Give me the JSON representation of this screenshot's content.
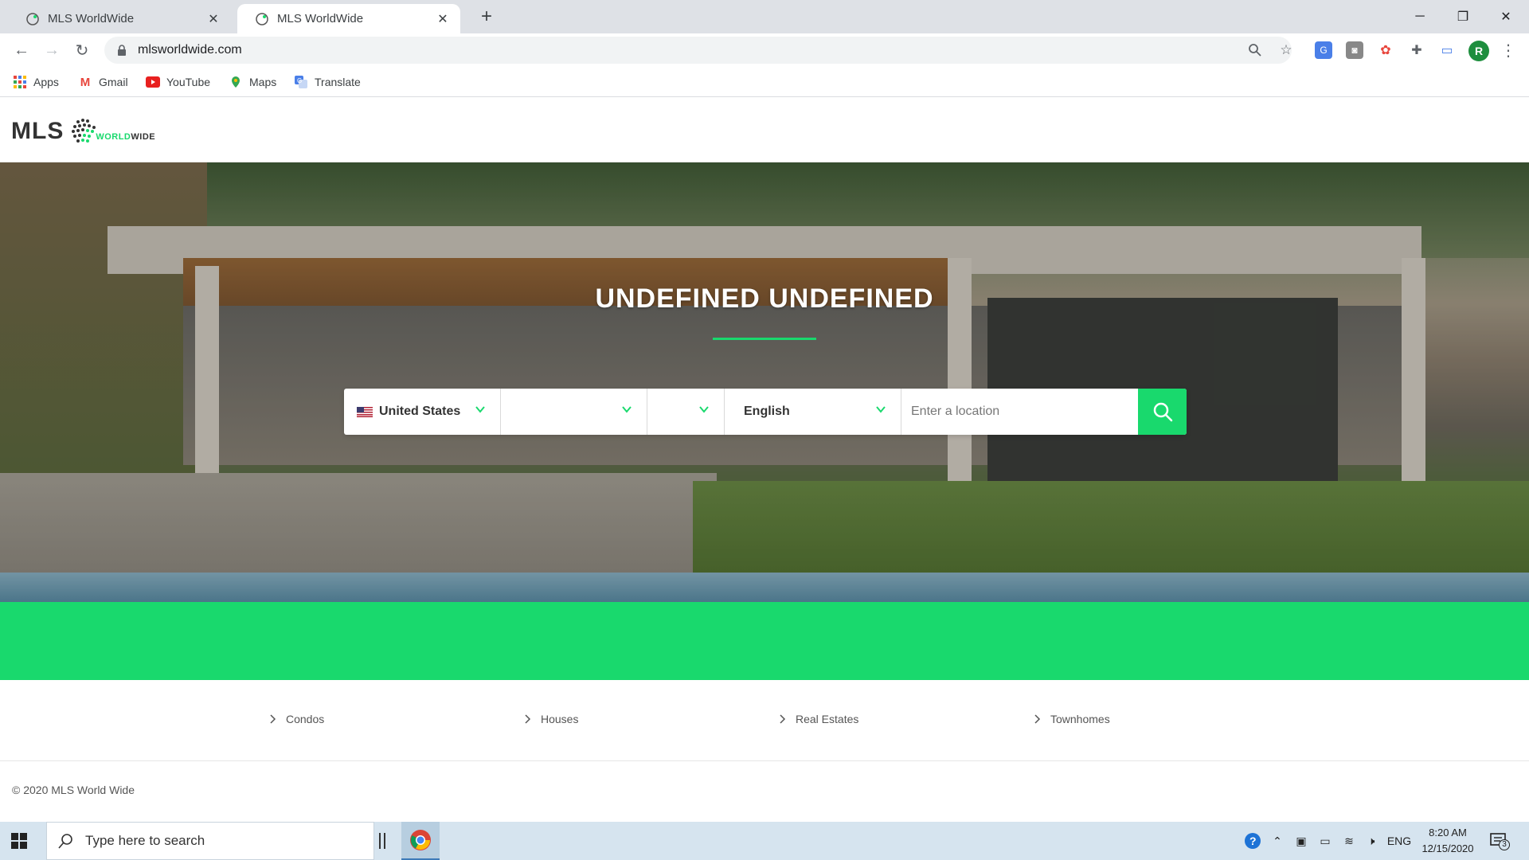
{
  "browser": {
    "tabs": [
      {
        "title": "MLS WorldWide",
        "active": false
      },
      {
        "title": "MLS WorldWide",
        "active": true
      }
    ],
    "url": "mlsworldwide.com",
    "profile_initial": "R",
    "bookmarks": [
      "Apps",
      "Gmail",
      "YouTube",
      "Maps",
      "Translate"
    ]
  },
  "site": {
    "logo_text": "MLS",
    "logo_sub_a": "WORLD",
    "logo_sub_b": "WIDE",
    "hero_title": "UNDEFINED UNDEFINED",
    "search": {
      "country": "United States",
      "field2": "",
      "field3": "",
      "language": "English",
      "location_placeholder": "Enter a location"
    },
    "categories": [
      "Condos",
      "Houses",
      "Real Estates",
      "Townhomes"
    ],
    "copyright": "© 2020 MLS World Wide",
    "accent_color": "#19d96d"
  },
  "taskbar": {
    "search_placeholder": "Type here to search",
    "language": "ENG",
    "time": "8:20 AM",
    "date": "12/15/2020",
    "notification_count": "3"
  }
}
